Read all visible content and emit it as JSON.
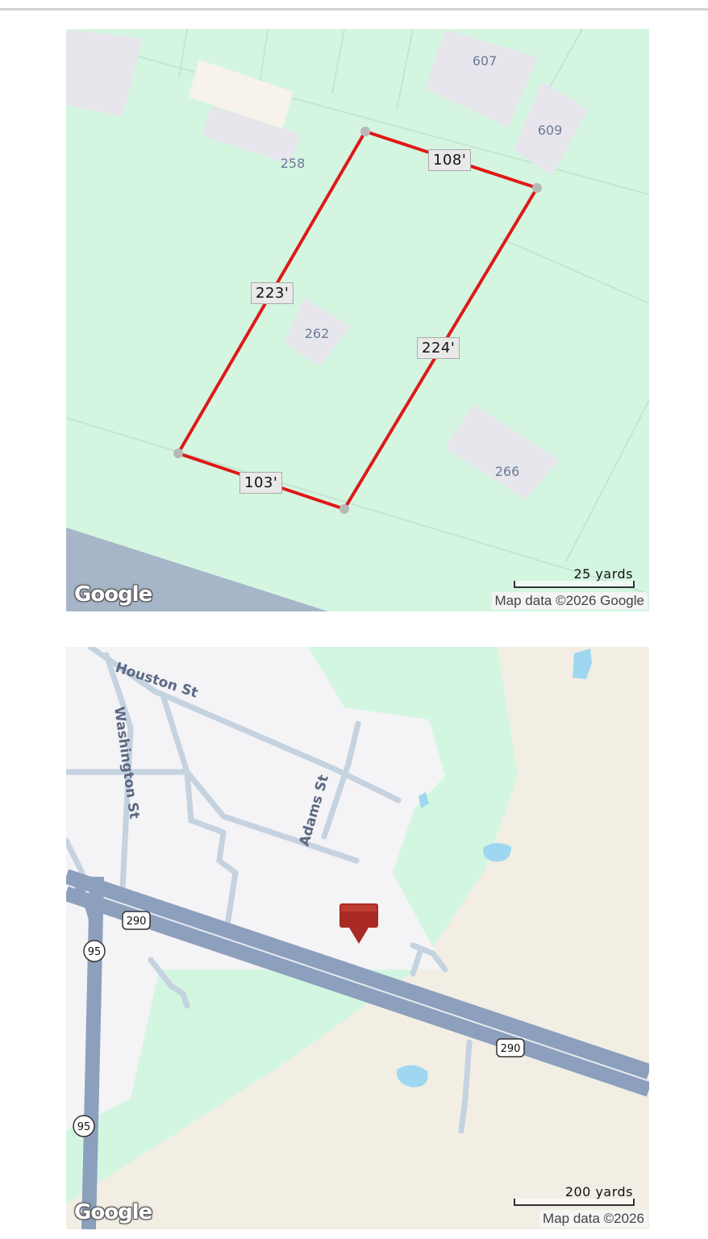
{
  "parcel_map": {
    "lot_numbers": {
      "n607": "607",
      "n609": "609",
      "n258": "258",
      "n262": "262",
      "n266": "266"
    },
    "measurements": {
      "top": "108'",
      "left": "223'",
      "right": "224'",
      "bottom": "103'"
    },
    "scale_label": "25 yards",
    "attribution": "Map data ©2026 Google",
    "logo": "Google",
    "colors": {
      "land": "#d4f6e1",
      "outline": "#e01818",
      "building": "#e7e7ec",
      "road": "#a6b5c8"
    }
  },
  "area_map": {
    "streets": {
      "houston": "Houston St",
      "washington": "Washington St",
      "adams": "Adams St"
    },
    "route_shields": {
      "us290_a": "290",
      "us290_b": "290",
      "i95_a": "95",
      "i95_b": "95"
    },
    "marker_icon": "location-marker-icon",
    "scale_label": "200 yards",
    "attribution": "Map data ©2026",
    "logo": "Google",
    "colors": {
      "urban": "#f4f3f5",
      "green": "#d3f6e1",
      "rural": "#f2eee4",
      "highway": "#8c9fbd",
      "water": "#9fd7f0",
      "marker": "#a82a22"
    }
  }
}
